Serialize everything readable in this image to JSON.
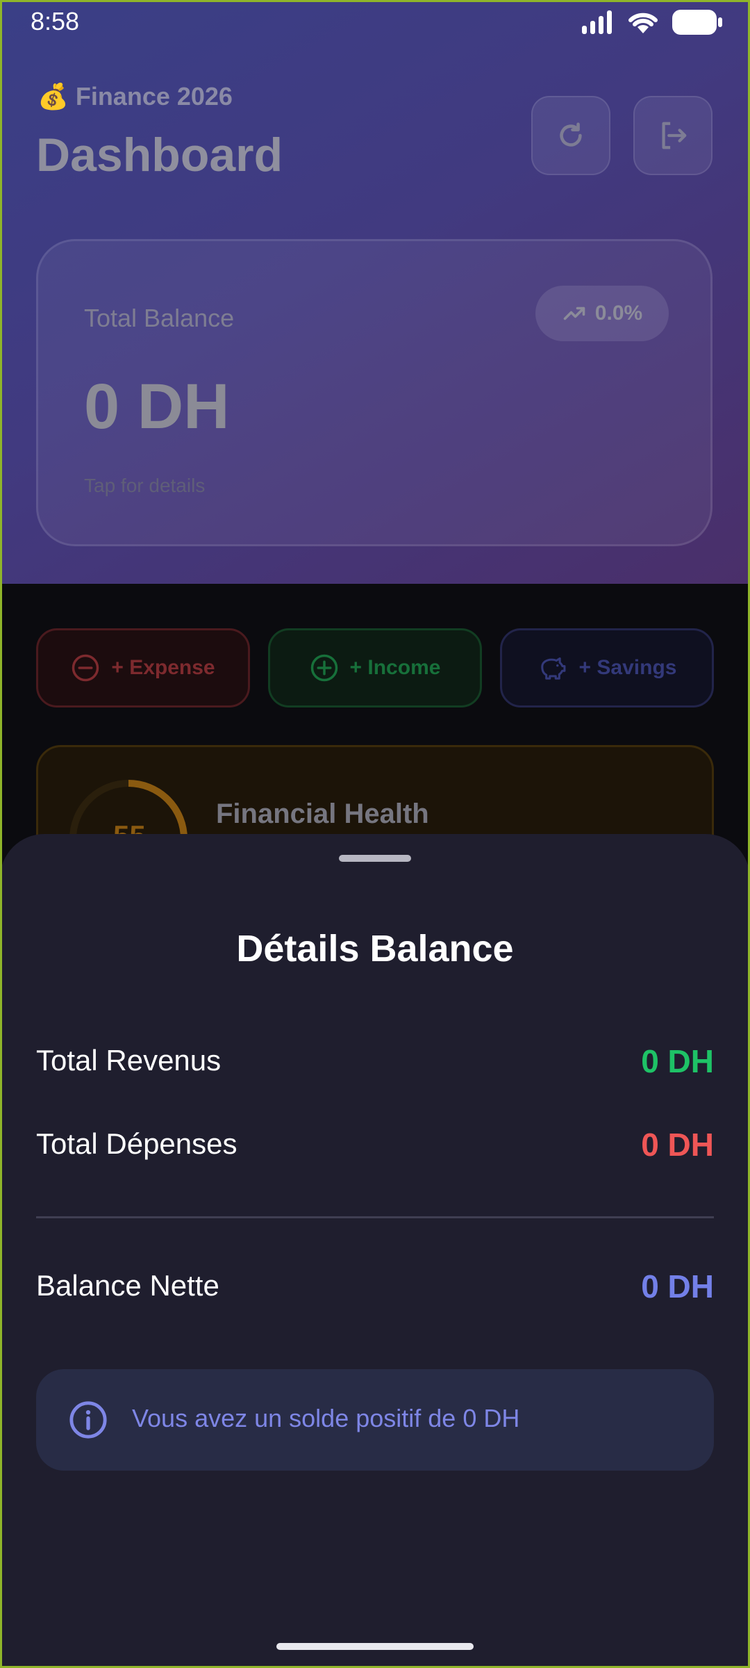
{
  "status_bar": {
    "time": "8:58"
  },
  "header": {
    "subtitle": "💰 Finance 2026",
    "title": "Dashboard",
    "refresh_icon": "refresh-icon",
    "logout_icon": "logout-icon"
  },
  "balance_card": {
    "label": "Total Balance",
    "value": "0 DH",
    "hint": "Tap for details",
    "trend": "0.0%",
    "trend_icon": "trending-up-icon"
  },
  "actions": [
    {
      "label": "+ Expense",
      "icon": "minus-circle-icon",
      "color": "#7d2a2e"
    },
    {
      "label": "+ Income",
      "icon": "plus-circle-icon",
      "color": "#17703a"
    },
    {
      "label": "+ Savings",
      "icon": "piggy-bank-icon",
      "color": "#33397a"
    }
  ],
  "health_card": {
    "score": "55",
    "title": "Financial Health"
  },
  "sheet": {
    "title": "Détails Balance",
    "rows": [
      {
        "label": "Total Revenus",
        "value": "0 DH",
        "color": "#1ec266"
      },
      {
        "label": "Total Dépenses",
        "value": "0 DH",
        "color": "#ef5656"
      },
      {
        "label": "Balance Nette",
        "value": "0 DH",
        "color": "#7380e8"
      }
    ],
    "info": {
      "icon": "info-icon",
      "text": "Vous avez un solde positif de 0 DH"
    }
  }
}
